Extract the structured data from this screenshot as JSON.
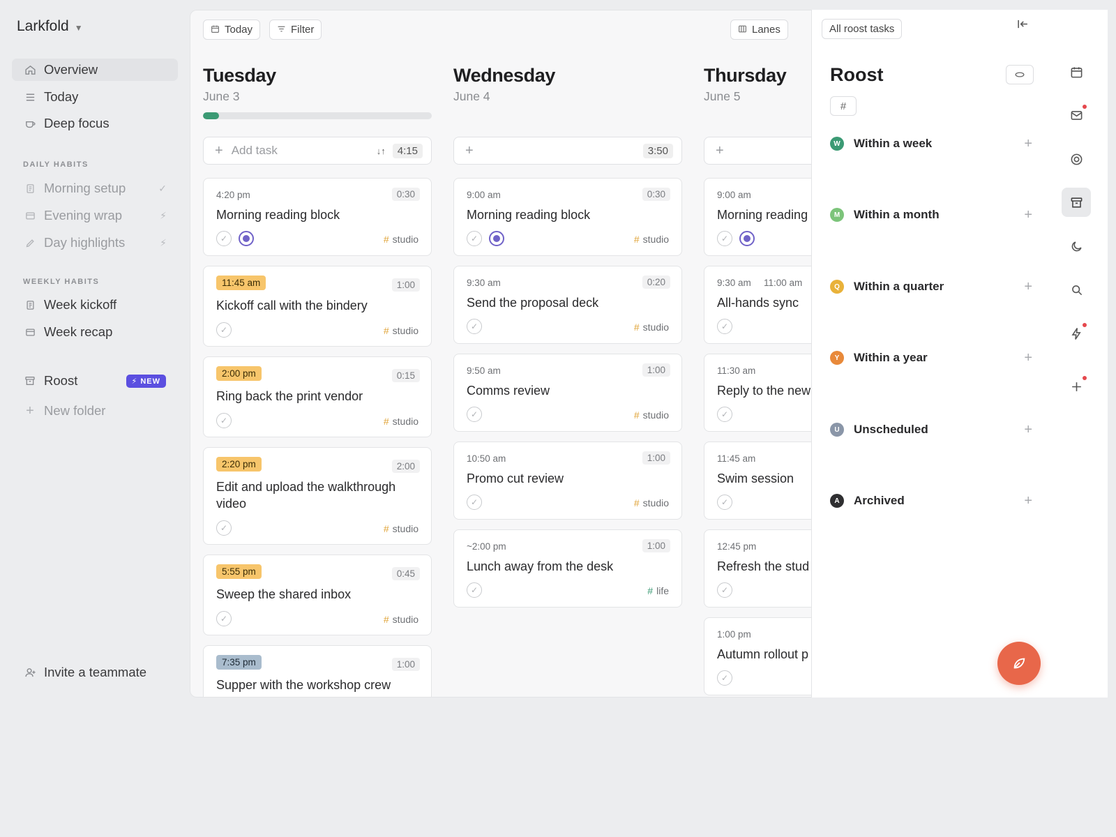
{
  "app": {
    "name": "Larkfold"
  },
  "sidebar": {
    "primary": [
      {
        "label": "Overview",
        "icon": "home-icon"
      },
      {
        "label": "Today",
        "icon": "list-icon"
      },
      {
        "label": "Deep focus",
        "icon": "cup-icon"
      }
    ],
    "daily_head": "DAILY HABITS",
    "daily": [
      {
        "label": "Morning setup",
        "trail": "✓"
      },
      {
        "label": "Evening wrap",
        "trail": "⚡"
      },
      {
        "label": "Day highlights",
        "trail": "⚡"
      }
    ],
    "weekly_head": "WEEKLY HABITS",
    "weekly": [
      {
        "label": "Week kickoff"
      },
      {
        "label": "Week recap"
      }
    ],
    "roost": {
      "label": "Roost",
      "badge": "NEW",
      "badge_icon": "⚡"
    },
    "new_folder": "New folder",
    "invite": "Invite a teammate"
  },
  "toolbar": {
    "today": "Today",
    "filter": "Filter",
    "lanes": "Lanes",
    "all_roost": "All roost tasks"
  },
  "days": [
    {
      "name": "Tuesday",
      "date": "June 3",
      "progress": 0.07,
      "add_label": "Add task",
      "total": "4:15",
      "tasks": [
        {
          "time": "4:20 pm",
          "dur": "0:30",
          "title": "Morning reading block",
          "tag": "studio"
        },
        {
          "time": "11:45 am",
          "dur": "1:00",
          "title": "Kickoff call with the bindery",
          "tag": "studio"
        },
        {
          "time": "2:00 pm",
          "dur": "0:15",
          "title": "Ring back the print vendor",
          "tag": "studio"
        },
        {
          "time": "2:20 pm",
          "dur": "2:00",
          "title": "Edit and upload the walkthrough video",
          "tag": "studio"
        },
        {
          "time": "5:55 pm",
          "dur": "0:45",
          "title": "Sweep the shared inbox",
          "tag": "studio"
        },
        {
          "time": "7:35 pm",
          "dur": "1:00",
          "title": "Supper with the workshop crew"
        }
      ]
    },
    {
      "name": "Wednesday",
      "date": "June 4",
      "total": "3:50",
      "tasks": [
        {
          "time": "9:00 am",
          "dur": "0:30",
          "title": "Morning reading block",
          "tag": "studio"
        },
        {
          "time": "9:30 am",
          "dur": "0:20",
          "title": "Send the proposal deck",
          "tag": "studio"
        },
        {
          "time": "9:50 am",
          "dur": "1:00",
          "title": "Comms review",
          "tag": "studio"
        },
        {
          "time": "10:50 am",
          "dur": "1:00",
          "title": "Promo cut review",
          "tag": "studio"
        },
        {
          "time": "~2:00 pm",
          "dur": "1:00",
          "title": "Lunch away from the desk",
          "tag": "life"
        }
      ]
    },
    {
      "name": "Thursday",
      "date": "June 5",
      "tasks": [
        {
          "time": "9:00 am",
          "title": "Morning reading"
        },
        {
          "time": "9:30 am",
          "time2": "11:00 am",
          "title": "All-hands sync"
        },
        {
          "time": "11:30 am",
          "title": "Reply to the new"
        },
        {
          "time": "11:45 am",
          "title": "Swim session"
        },
        {
          "time": "12:45 pm",
          "title": "Refresh the stud"
        },
        {
          "time": "1:00 pm",
          "title": "Autumn rollout p"
        }
      ]
    }
  ],
  "roost": {
    "title": "Roost",
    "hash": "#",
    "buckets": [
      {
        "letter": "W",
        "label": "Within a week",
        "color": "#3b9a74"
      },
      {
        "letter": "M",
        "label": "Within a month",
        "color": "#7cc47a"
      },
      {
        "letter": "Q",
        "label": "Within a quarter",
        "color": "#e9b23a"
      },
      {
        "letter": "Y",
        "label": "Within a year",
        "color": "#e8893a"
      },
      {
        "letter": "U",
        "label": "Unscheduled",
        "color": "#8a96a8"
      },
      {
        "letter": "A",
        "label": "Archived",
        "color": "#2f2f31"
      }
    ]
  },
  "colors": {
    "accent": "#3b9a74",
    "fab": "#e8674a",
    "badge": "#5b4fe0",
    "focus": "#7062c8"
  }
}
